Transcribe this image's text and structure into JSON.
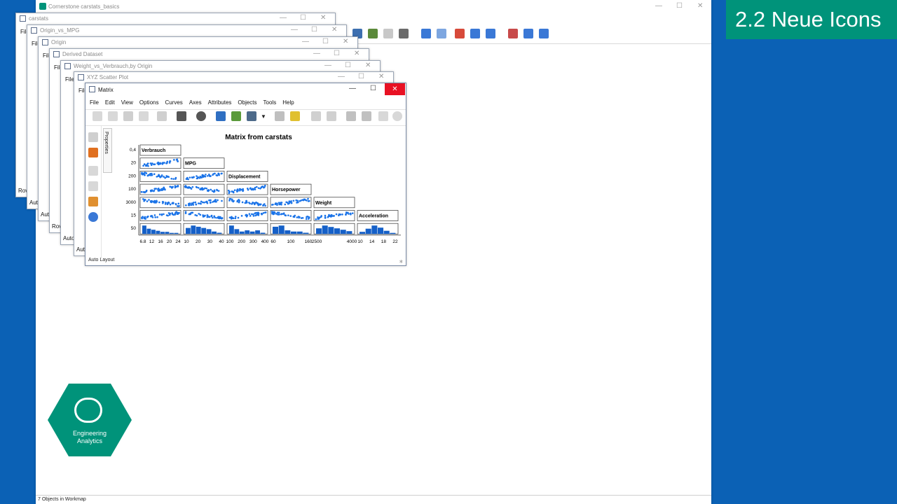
{
  "banner": {
    "title": "2.2 Neue Icons"
  },
  "main_window": {
    "title": "Cornerstone carstats_basics",
    "status": "7 Objects in Workmap"
  },
  "stacked_windows": [
    {
      "title": "carstats",
      "side": "File",
      "side2": "Rov"
    },
    {
      "title": "Origin_vs_MPG",
      "side": "File",
      "side2": "Auto"
    },
    {
      "title": "Origin",
      "side": "File",
      "side2": "Auto"
    },
    {
      "title": "Derived Dataset",
      "side": "File",
      "side2": "Rov"
    },
    {
      "title": "Weight_vs_Verbrauch,by Origin",
      "side": "File",
      "side2": "Auto"
    },
    {
      "title": "XYZ Scatter Plot",
      "side": "File",
      "side2": "Auto"
    }
  ],
  "matrix_window": {
    "title": "Matrix",
    "menus": [
      "File",
      "Edit",
      "View",
      "Options",
      "Curves",
      "Axes",
      "Attributes",
      "Objects",
      "Tools",
      "Help"
    ],
    "side_tab": "Properties",
    "status": "Auto Layout"
  },
  "chart_data": {
    "type": "scatter-matrix",
    "title": "Matrix from carstats",
    "variables": [
      "Verbrauch",
      "MPG",
      "Displacement",
      "Horsepower",
      "Weight",
      "Acceleration"
    ],
    "y_ticks": [
      "0,4",
      "20",
      "200",
      "100",
      "3000",
      "15",
      "50"
    ],
    "x_ticks": [
      [
        "6.8",
        "12",
        "16",
        "20",
        "24"
      ],
      [
        "10",
        "20",
        "30",
        "40"
      ],
      [
        "100",
        "200",
        "300",
        "400"
      ],
      [
        "60",
        "100",
        "160"
      ],
      [
        "2500",
        "4000"
      ],
      [
        "10",
        "14",
        "18",
        "22"
      ]
    ],
    "histograms": [
      [
        8,
        5,
        4,
        3,
        2,
        2,
        1,
        1
      ],
      [
        5,
        7,
        6,
        5,
        4,
        2,
        1
      ],
      [
        7,
        4,
        2,
        3,
        2,
        3,
        1
      ],
      [
        6,
        7,
        3,
        2,
        2,
        1
      ],
      [
        4,
        6,
        5,
        4,
        3,
        2
      ],
      [
        2,
        5,
        8,
        6,
        3,
        1
      ]
    ]
  },
  "colors": {
    "accent": "#00937a",
    "background": "#0b61b5",
    "points": "#1a73e8"
  },
  "logo": {
    "line1": "Engineering",
    "line2": "Analytics"
  }
}
